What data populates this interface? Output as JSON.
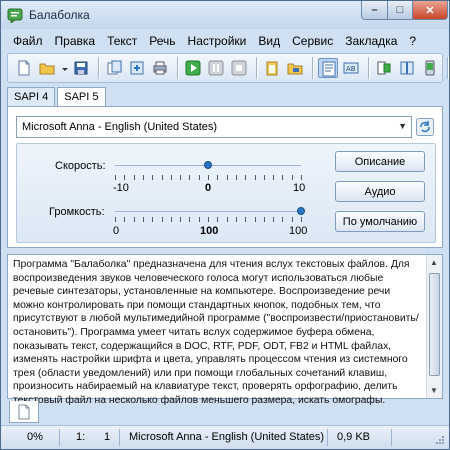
{
  "window": {
    "title": "Балаболка"
  },
  "menu": [
    "Файл",
    "Правка",
    "Текст",
    "Речь",
    "Настройки",
    "Вид",
    "Сервис",
    "Закладка",
    "?"
  ],
  "toolbar": {
    "buttons": [
      "new-document-icon",
      "open-folder-icon",
      "save-icon",
      "convert-icon",
      "export-icon",
      "print-icon",
      "play-icon",
      "pause-icon",
      "stop-icon",
      "clipboard-icon",
      "folder-icon",
      "text-view-icon",
      "settings-icon",
      "voice-icon",
      "book-icon",
      "phone-icon",
      "help-icon"
    ]
  },
  "tabs": [
    {
      "label": "SAPI 4",
      "selected": false
    },
    {
      "label": "SAPI 5",
      "selected": true
    }
  ],
  "voice": {
    "selected": "Microsoft Anna - English (United States)"
  },
  "sliders": {
    "speed": {
      "label": "Скорость:",
      "min": "-10",
      "value": "0",
      "max": "10",
      "level": 0.5
    },
    "volume": {
      "label": "Громкость:",
      "min": "0",
      "value": "100",
      "max": "100",
      "level": 1.0
    }
  },
  "buttons": {
    "description": "Описание",
    "audio": "Аудио",
    "default": "По умолчанию"
  },
  "document": {
    "text": "Программа \"Балаболка\" предназначена для чтения вслух текстовых файлов. Для воспроизведения звуков человеческого голоса могут использоваться любые речевые синтезаторы, установленные на компьютере. Воспроизведение речи можно контролировать при помощи стандартных кнопок, подобных тем, что присутствуют в любой мультимедийной программе (\"воспроизвести/приостановить/остановить\"). Программа умеет читать вслух содержимое буфера обмена, показывать текст, содержащийся в DOC, RTF, PDF, ODT, FB2 и HTML файлах, изменять настройки шрифта и цвета, управлять процессом чтения из системного трея (области уведомлений) или при помощи глобальных сочетаний клавиш, произносить набираемый на клавиатуре текст, проверять орфографию, делить текстовый файл на несколько файлов меньшего размера, искать омографы."
  },
  "status": {
    "progress": "0%",
    "line": "1:",
    "column": "1",
    "voice": "Microsoft Anna - English (United States)",
    "size": "0,9 KB"
  },
  "colors": {
    "window_bg": "#cfe0f2",
    "accent": "#2b78c2",
    "close_button": "#c7452b"
  }
}
